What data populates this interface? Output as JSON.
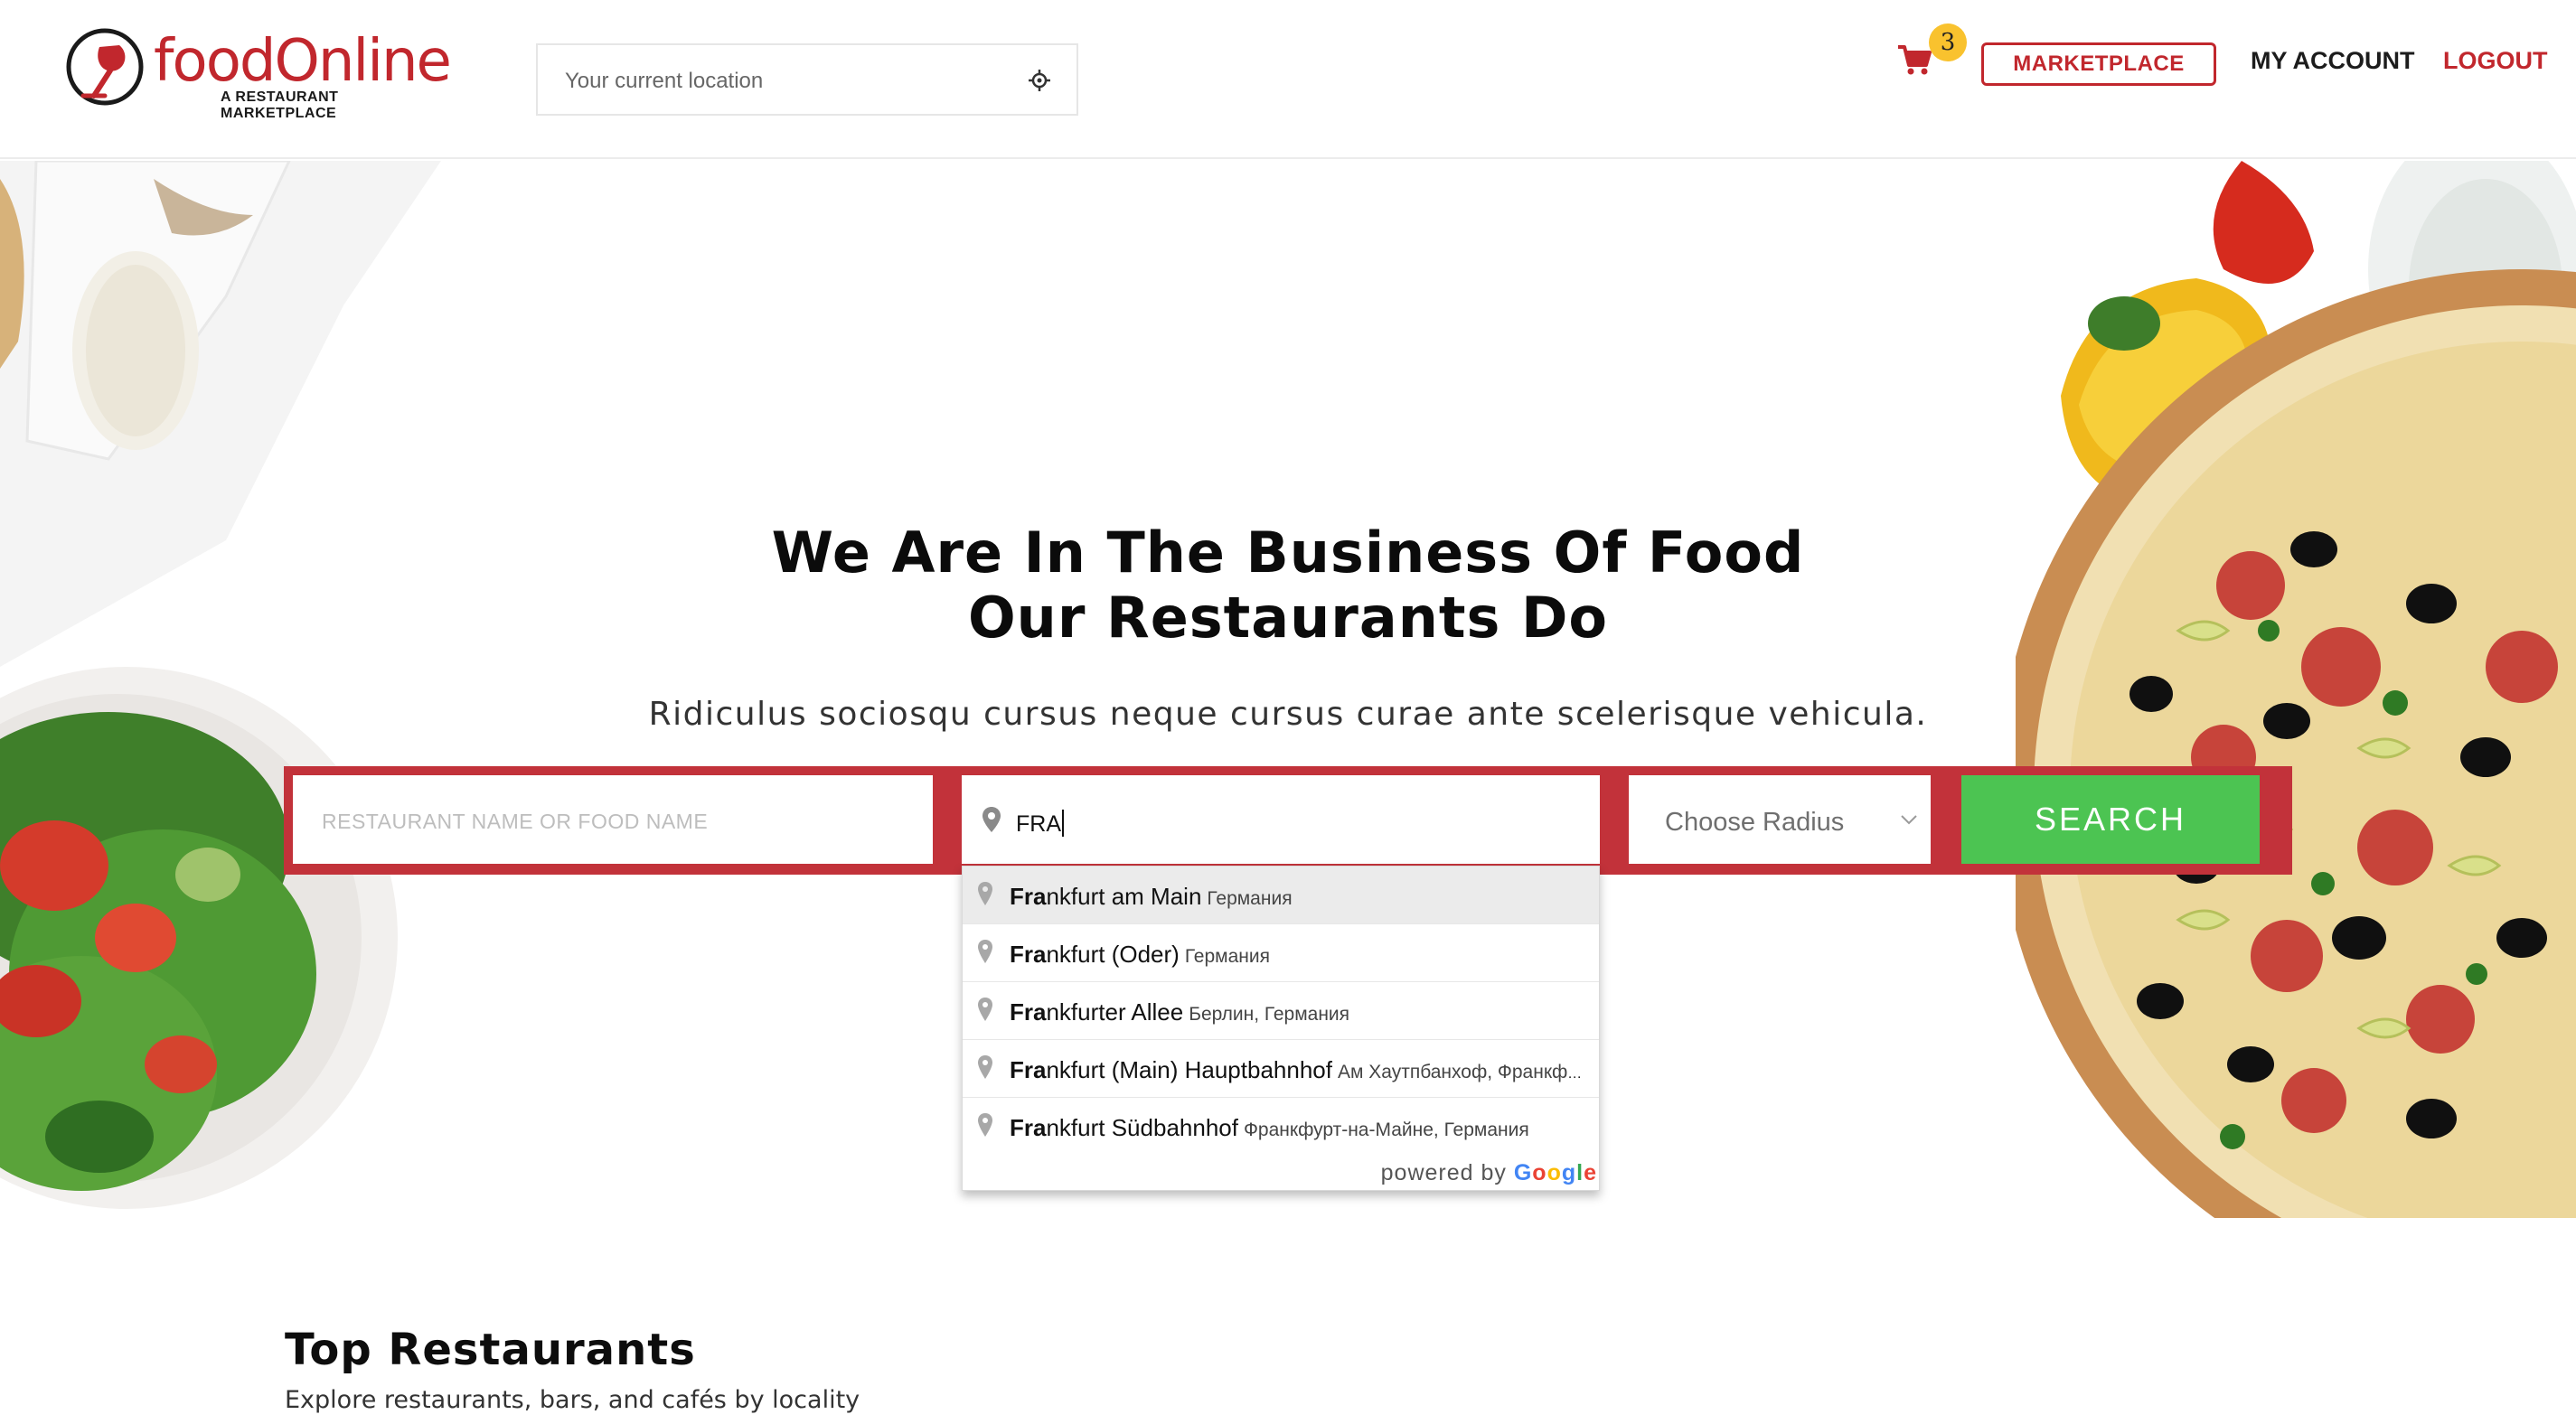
{
  "header": {
    "logo": {
      "name": "foodOnline",
      "tagline": "A RESTAURANT MARKETPLACE"
    },
    "location_placeholder": "Your current location",
    "cart_count": "3",
    "nav": {
      "marketplace": "MARKETPLACE",
      "my_account": "MY ACCOUNT",
      "logout": "LOGOUT"
    }
  },
  "hero": {
    "title_line1": "We Are In The Business Of Food",
    "title_line2": "Our Restaurants Do",
    "subtitle": "Ridiculus sociosqu cursus neque cursus curae ante scelerisque vehicula.",
    "search": {
      "food_placeholder": "RESTAURANT NAME OR FOOD NAME",
      "location_value": "FRA",
      "radius_value": "Choose Radius",
      "search_label": "SEARCH"
    }
  },
  "autocomplete": {
    "items": [
      {
        "match": "Fra",
        "rest": "nkfurt am Main",
        "secondary": "Германия"
      },
      {
        "match": "Fra",
        "rest": "nkfurt (Oder)",
        "secondary": "Германия"
      },
      {
        "match": "Fra",
        "rest": "nkfurter Allee",
        "secondary": "Берлин, Германия"
      },
      {
        "match": "Fra",
        "rest": "nkfurt (Main) Hauptbahnhof",
        "secondary": "Ам Хаутпбанхоф, Франкфурт-на-Майне, Германия"
      },
      {
        "match": "Fra",
        "rest": "nkfurt Südbahnhof",
        "secondary": "Франкфурт-на-Майне, Германия"
      }
    ],
    "powered_by": "powered by",
    "google": "Google"
  },
  "section": {
    "title": "Top Restaurants",
    "subtitle": "Explore restaurants, bars, and cafés by locality"
  },
  "colors": {
    "brand_red": "#c1272d",
    "search_green": "#4cc452",
    "badge_yellow": "#f9c22e"
  }
}
